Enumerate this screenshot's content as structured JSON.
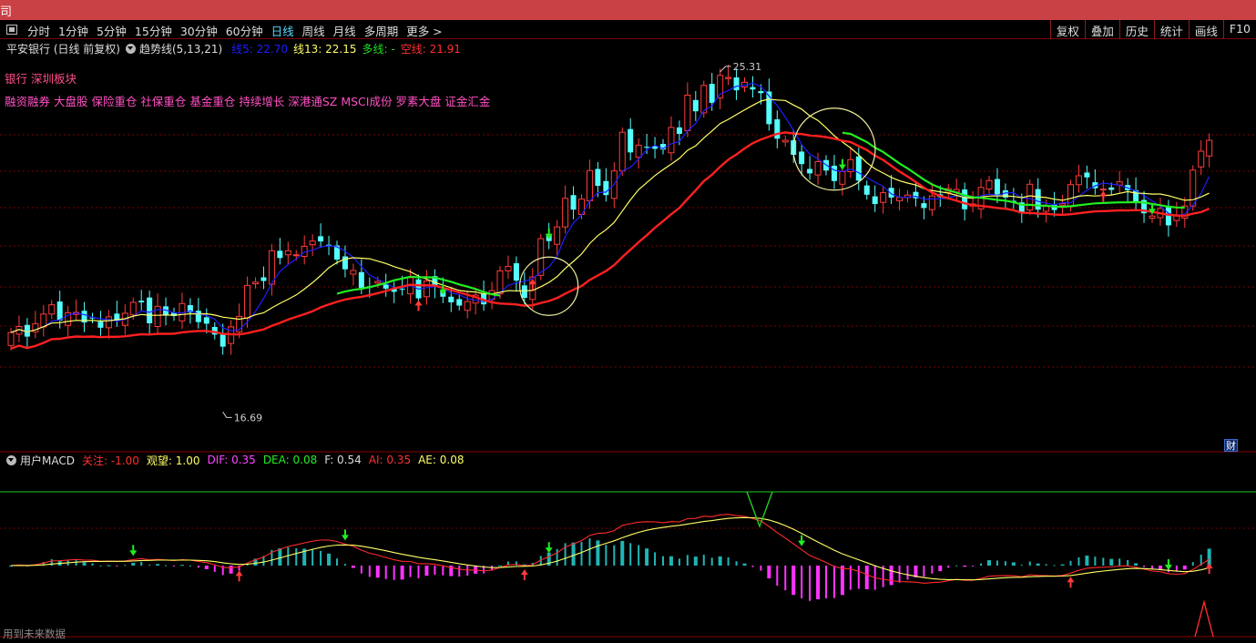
{
  "window": {
    "title": "司"
  },
  "toolbar": {
    "periods": [
      "分时",
      "1分钟",
      "5分钟",
      "15分钟",
      "30分钟",
      "60分钟",
      "日线",
      "周线",
      "月线",
      "多周期",
      "更多 >"
    ],
    "active_period": "日线",
    "right_buttons": [
      "复权",
      "叠加",
      "历史",
      "统计",
      "画线",
      "F10"
    ]
  },
  "indicator": {
    "stock": "平安银行 (日线 前复权)",
    "name": "趋势线(5,13,21)",
    "line5": "线5: 22.70",
    "line13": "线13: 22.15",
    "duo": "多线: -",
    "kong": "空线: 21.91"
  },
  "tags": {
    "line1": "银行  深圳板块",
    "line2": "融资融券  大盘股  保险重仓  社保重仓  基金重仓  持续增长  深港通SZ  MSCI成份  罗素大盘  证金汇金"
  },
  "annotations": {
    "high": "25.31",
    "low": "16.69",
    "cai": "财"
  },
  "macd": {
    "name": "用户MACD",
    "guanzhu": "关注: -1.00",
    "guanwang": "观望: 1.00",
    "dif": "DIF: 0.35",
    "dea": "DEA: 0.08",
    "f": "F: 0.54",
    "ai": "AI: 0.35",
    "ae": "AE: 0.08"
  },
  "footer": {
    "note": "用到未来数据"
  },
  "colors": {
    "up": "#ff3a3a",
    "down": "#54ffff",
    "ma5": "#1e1eff",
    "ma13": "#ffff66",
    "long": "#ff2020",
    "short": "#22ee22",
    "hist_pos": "#1fb5b5",
    "hist_neg": "#ff33ff",
    "accent": "#58d8ff"
  },
  "chart_data": {
    "type": "candlestick",
    "closes": [
      18.75,
      18.9,
      18.65,
      18.97,
      19.21,
      19.44,
      19.05,
      19.24,
      19.25,
      19.0,
      19.1,
      18.87,
      19.14,
      19.05,
      19.23,
      19.5,
      19.5,
      18.98,
      19.4,
      19.17,
      19.16,
      19.47,
      19.25,
      19.01,
      18.97,
      18.7,
      18.4,
      18.89,
      19.15,
      19.92,
      20.0,
      20.03,
      20.78,
      20.6,
      20.78,
      20.68,
      20.89,
      21.02,
      21.01,
      20.91,
      20.56,
      20.32,
      20.29,
      19.86,
      19.86,
      20.02,
      19.84,
      19.76,
      19.83,
      20.11,
      19.6,
      20.03,
      19.88,
      19.64,
      19.5,
      19.42,
      19.52,
      19.68,
      19.45,
      19.79,
      20.28,
      20.39,
      20.04,
      19.61,
      20.13,
      21.08,
      21.02,
      21.37,
      22.08,
      21.8,
      22.06,
      22.77,
      22.39,
      22.16,
      22.76,
      23.72,
      23.22,
      23.4,
      23.34,
      23.31,
      23.29,
      23.84,
      23.68,
      24.64,
      24.24,
      24.88,
      24.45,
      25.13,
      25.08,
      24.76,
      24.96,
      24.78,
      24.69,
      23.92,
      23.56,
      23.52,
      23.16,
      22.93,
      22.7,
      22.99,
      22.77,
      22.51,
      22.74,
      23.04,
      22.52,
      22.17,
      21.94,
      22.22,
      22.1,
      22.1,
      22.16,
      22.08,
      21.84,
      22.14,
      22.11,
      22.32,
      22.3,
      21.81,
      21.94,
      22.35,
      22.52,
      22.16,
      22.1,
      21.98,
      21.71,
      22.43,
      21.8,
      21.88,
      21.79,
      21.95,
      22.42,
      22.64,
      22.6,
      22.33,
      22.31,
      22.29,
      22.49,
      22.28,
      21.96,
      21.71,
      21.64,
      21.83,
      21.41,
      21.67,
      21.89,
      22.78,
      23.25,
      23.52
    ],
    "x_count": 148,
    "high": 25.31,
    "low": 16.69,
    "ma5_last": 22.7,
    "ma13_last": 22.15,
    "long_line_last": 21.91,
    "macd_dif_last": 0.35,
    "macd_dea_last": 0.08
  }
}
